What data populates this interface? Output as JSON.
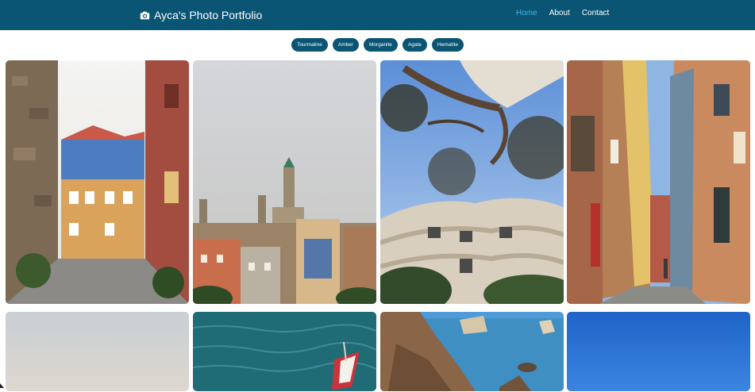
{
  "navbar": {
    "brand": "Ayca's Photo Portfolio",
    "brand_icon": "camera-icon",
    "bg_color": "#0a5574",
    "active_color": "#49b4e6",
    "links": [
      {
        "label": "Home",
        "active": true
      },
      {
        "label": "About",
        "active": false
      },
      {
        "label": "Contact",
        "active": false
      }
    ]
  },
  "filters": [
    "Tourmaline",
    "Amber",
    "Morganite",
    "Agate",
    "Hematite"
  ],
  "gallery": {
    "rows": [
      [
        "porto-alley-photo",
        "porto-skyline-photo",
        "casa-mila-tree-photo",
        "narrow-street-photo"
      ],
      [
        "hazy-sky-photo",
        "boat-on-sea-photo",
        "coastal-cliffs-photo",
        "blue-sky-photo"
      ]
    ]
  }
}
